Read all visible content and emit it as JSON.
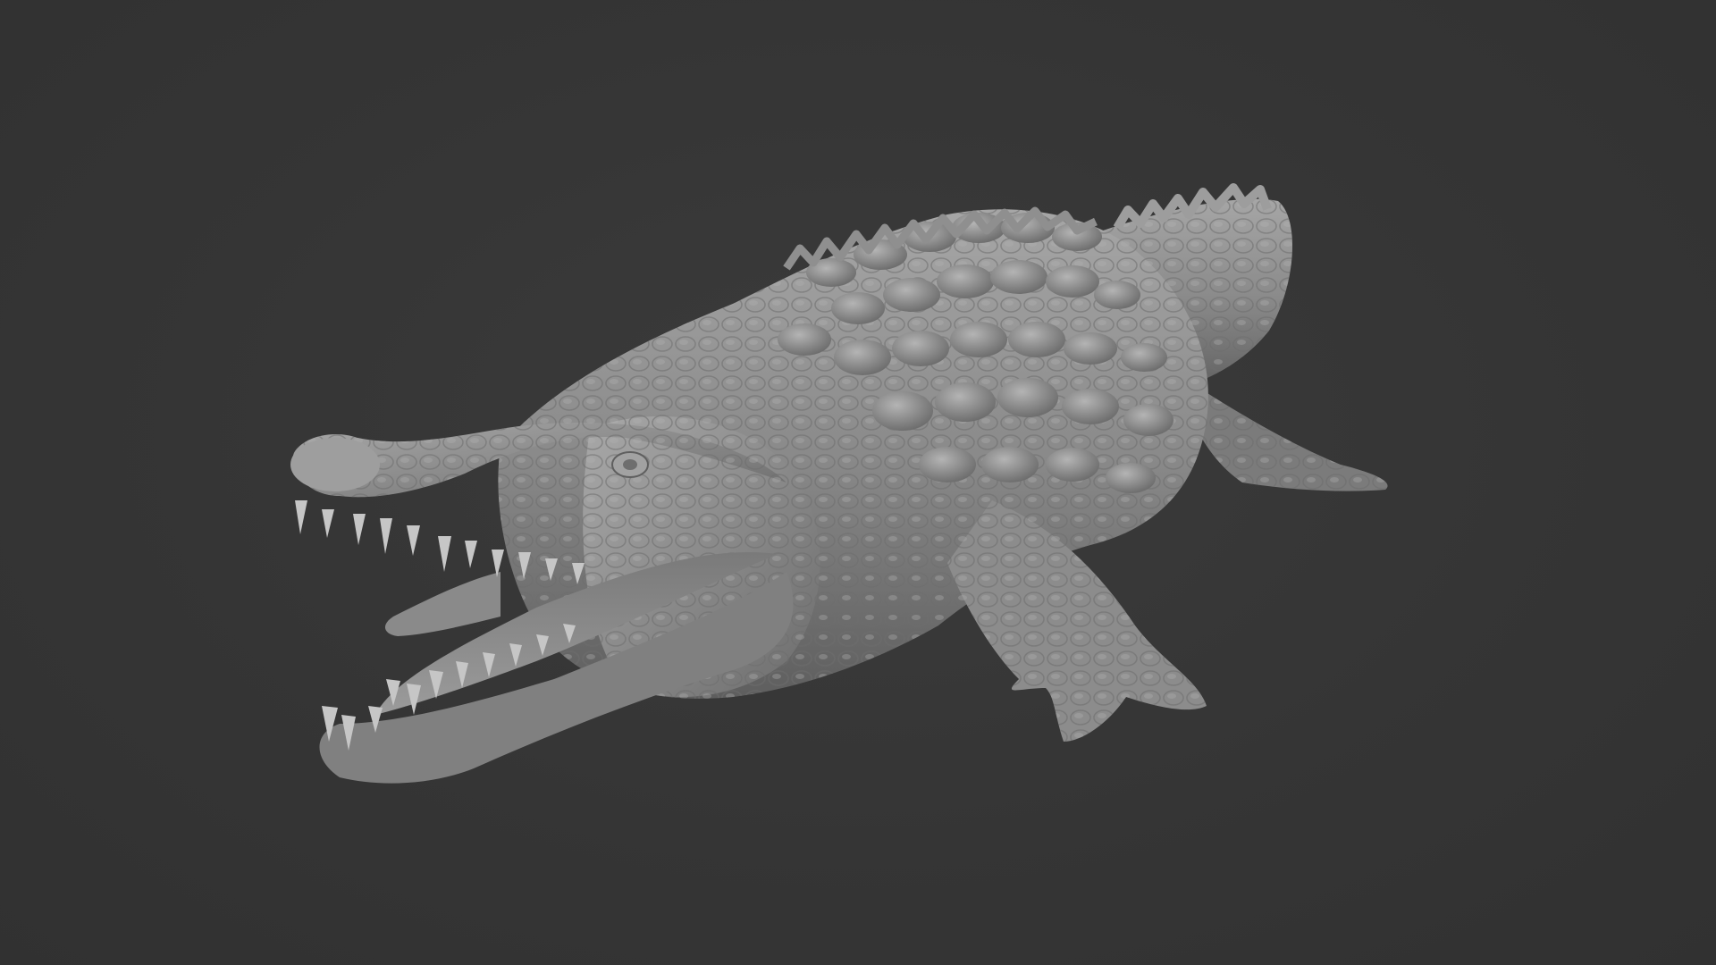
{
  "viewport": {
    "background_color": "#343434",
    "subject": "crocodile-sculpt",
    "material": "clay-gray",
    "material_color": "#8e8e8e"
  }
}
